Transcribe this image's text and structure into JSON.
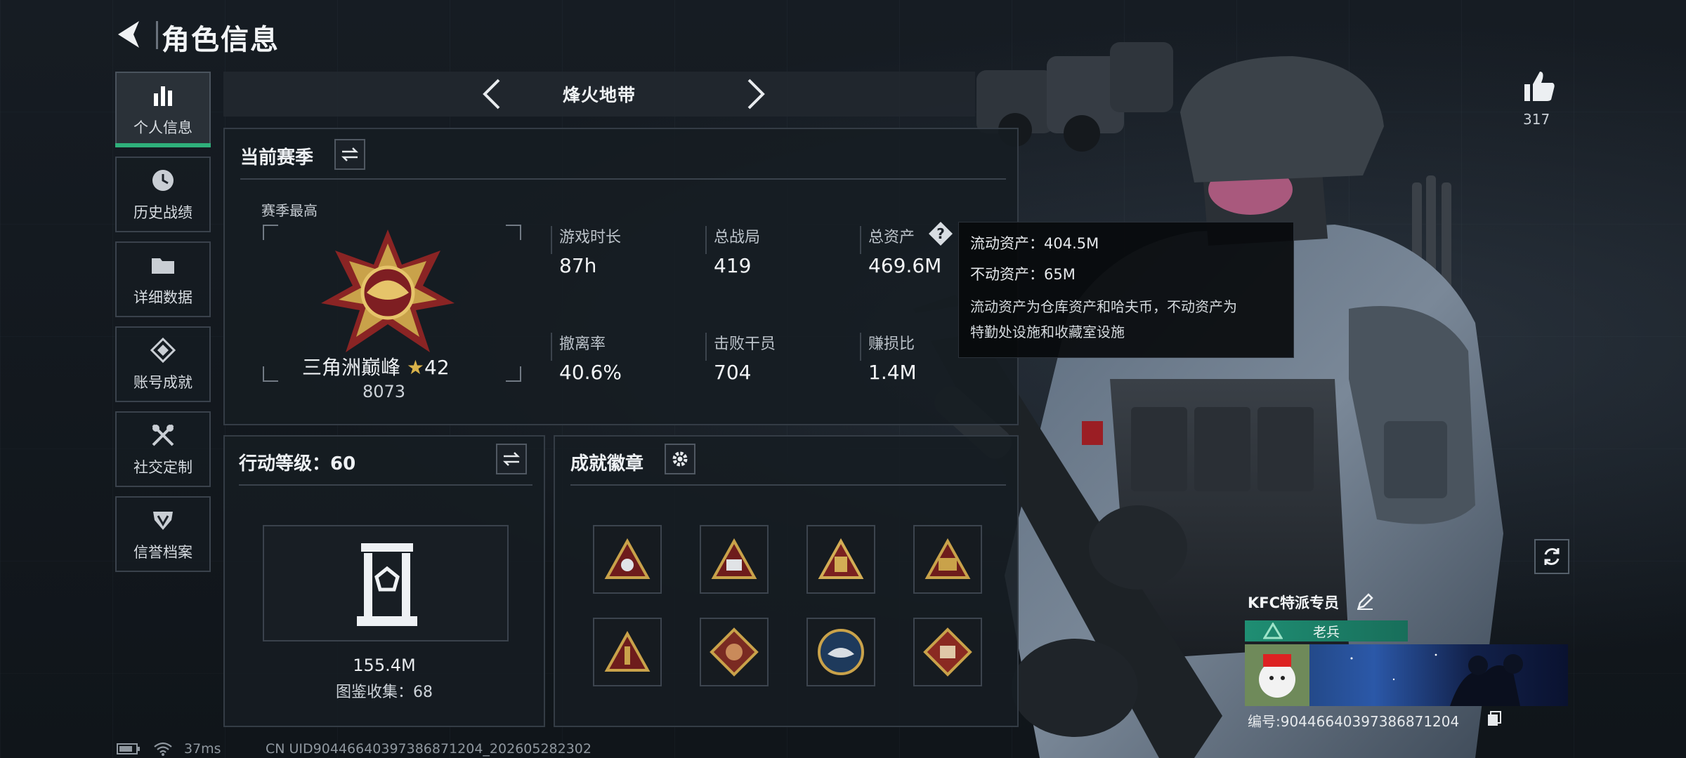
{
  "header": {
    "title": "角色信息"
  },
  "nav": {
    "items": [
      {
        "label": "个人信息",
        "icon": "bar-chart-icon",
        "active": true
      },
      {
        "label": "历史战绩",
        "icon": "clock-icon"
      },
      {
        "label": "详细数据",
        "icon": "folder-icon"
      },
      {
        "label": "账号成就",
        "icon": "achievement-icon"
      },
      {
        "label": "社交定制",
        "icon": "tools-icon"
      },
      {
        "label": "信誉档案",
        "icon": "shield-icon"
      }
    ]
  },
  "season_bar": {
    "name": "烽火地带"
  },
  "current_season": {
    "title": "当前赛季",
    "best_label": "赛季最高",
    "rank_name": "三角洲巅峰",
    "rank_stars": "42",
    "rank_score": "8073",
    "stats": [
      {
        "label": "游戏时长",
        "value": "87h"
      },
      {
        "label": "总战局",
        "value": "419"
      },
      {
        "label": "总资产",
        "value": "469.6M"
      },
      {
        "label": "撤离率",
        "value": "40.6%"
      },
      {
        "label": "击败干员",
        "value": "704"
      },
      {
        "label": "赚损比",
        "value": "1.4M"
      }
    ]
  },
  "tooltip": {
    "liquid": "流动资产：404.5M",
    "fixed": "不动资产：65M",
    "desc_line1": "流动资产为仓库资产和哈夫币，不动资产为",
    "desc_line2": "特勤处设施和收藏室设施"
  },
  "action_level": {
    "title": "行动等级：60",
    "value": "155.4M",
    "collection": "图鉴收集：68"
  },
  "achievements": {
    "title": "成就徽章"
  },
  "likes": {
    "count": "317"
  },
  "card": {
    "name": "KFC特派专员",
    "rank": "老兵",
    "id": "编号:9044664039738687​1204"
  },
  "status": {
    "ping": "37ms",
    "uid": "CN UID9044664039738687​1204_202605282302"
  },
  "colors": {
    "accent": "#2fb07b",
    "panel": "#161c22",
    "gold": "#c9a24a",
    "rank_bar": "#1f8e73"
  }
}
